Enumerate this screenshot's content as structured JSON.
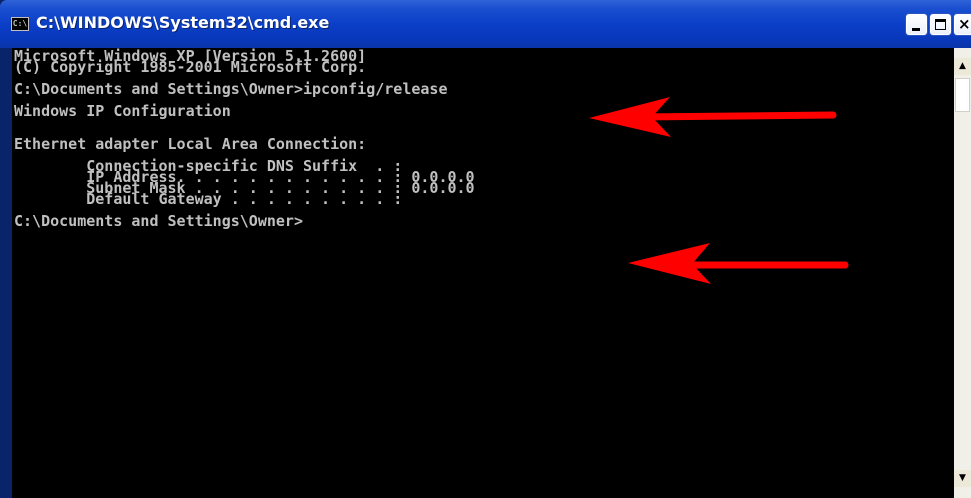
{
  "window": {
    "title": "C:\\WINDOWS\\System32\\cmd.exe",
    "icon": "cmd-console-icon",
    "icon_glyph": "C:\\",
    "controls": {
      "minimize_icon": "minimize-icon",
      "maximize_icon": "maximize-icon",
      "close_icon": "close-icon",
      "close_glyph": "×"
    }
  },
  "console": {
    "lines": [
      "Microsoft Windows XP [Version 5.1.2600]",
      "(C) Copyright 1985-2001 Microsoft Corp.",
      "",
      "C:\\Documents and Settings\\Owner>ipconfig/release",
      "",
      "Windows IP Configuration",
      "",
      "",
      "Ethernet adapter Local Area Connection:",
      "",
      "        Connection-specific DNS Suffix  . :",
      "        IP Address. . . . . . . . . . . . : 0.0.0.0",
      "        Subnet Mask . . . . . . . . . . . : 0.0.0.0",
      "        Default Gateway . . . . . . . . . :",
      "",
      "C:\\Documents and Settings\\Owner>"
    ]
  },
  "scrollbar": {
    "up_glyph": "▲",
    "down_glyph": "▼"
  },
  "annotations": {
    "arrow_color": "#ff0000",
    "arrows": [
      "annotation-arrow-release-command",
      "annotation-arrow-ip-address"
    ]
  },
  "colors": {
    "titlebar": "#0b3fc8",
    "console_background": "#000000",
    "console_text": "#c0c0c0"
  }
}
